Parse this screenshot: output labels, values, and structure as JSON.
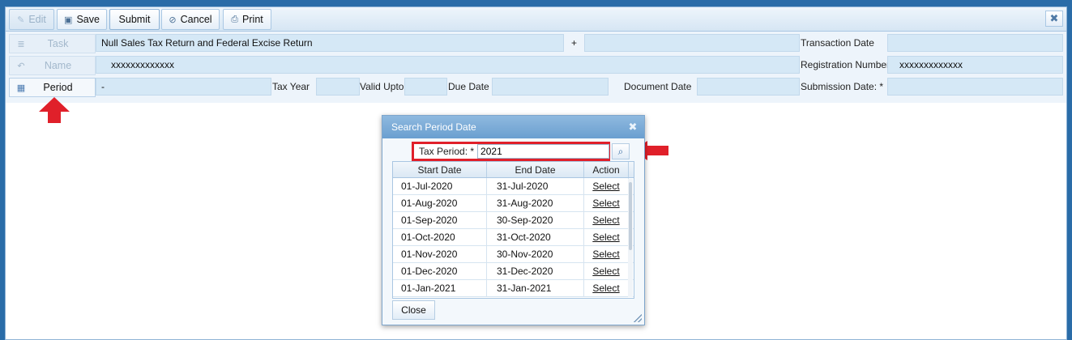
{
  "toolbar": {
    "edit_label": "Edit",
    "save_label": "Save",
    "submit_label": "Submit",
    "cancel_label": "Cancel",
    "print_label": "Print"
  },
  "sidebar": {
    "task_label": "Task",
    "name_label": "Name",
    "period_label": "Period"
  },
  "form": {
    "task_value": "Null Sales Tax Return and Federal Excise Return",
    "plus": "+",
    "task_extra_value": "",
    "transaction_date_label": "Transaction Date",
    "transaction_date_value": "",
    "name_value": "xxxxxxxxxxxxx",
    "registration_number_label": "Registration Number",
    "registration_number_value": "xxxxxxxxxxxxx",
    "period_value": "-",
    "tax_year_label": "Tax Year",
    "tax_year_value": "",
    "valid_upto_label": "Valid Upto",
    "valid_upto_value": "",
    "due_date_label": "Due Date",
    "due_date_value": "",
    "document_date_label": "Document Date",
    "document_date_value": "",
    "submission_date_label": "Submission Date: *",
    "submission_date_value": ""
  },
  "dialog": {
    "title": "Search Period Date",
    "tax_period_label": "Tax Period: *",
    "tax_period_value": "2021",
    "columns": [
      "Start Date",
      "End Date",
      "Action"
    ],
    "rows": [
      {
        "start": "01-Jul-2020",
        "end": "31-Jul-2020",
        "action": "Select"
      },
      {
        "start": "01-Aug-2020",
        "end": "31-Aug-2020",
        "action": "Select"
      },
      {
        "start": "01-Sep-2020",
        "end": "30-Sep-2020",
        "action": "Select"
      },
      {
        "start": "01-Oct-2020",
        "end": "31-Oct-2020",
        "action": "Select"
      },
      {
        "start": "01-Nov-2020",
        "end": "30-Nov-2020",
        "action": "Select"
      },
      {
        "start": "01-Dec-2020",
        "end": "31-Dec-2020",
        "action": "Select"
      },
      {
        "start": "01-Jan-2021",
        "end": "31-Jan-2021",
        "action": "Select"
      }
    ],
    "close_label": "Close"
  },
  "colors": {
    "annotation_red": "#e0202a",
    "header_blue": "#2a6ca8",
    "field_blue": "#d5e8f6"
  },
  "icons": {
    "edit": "pencil-icon",
    "save": "floppy-disk-icon",
    "cancel": "cancel-icon",
    "print": "printer-icon",
    "task": "list-icon",
    "name": "undo-icon",
    "period": "calendar-icon",
    "search": "search-icon",
    "close": "close-icon"
  }
}
